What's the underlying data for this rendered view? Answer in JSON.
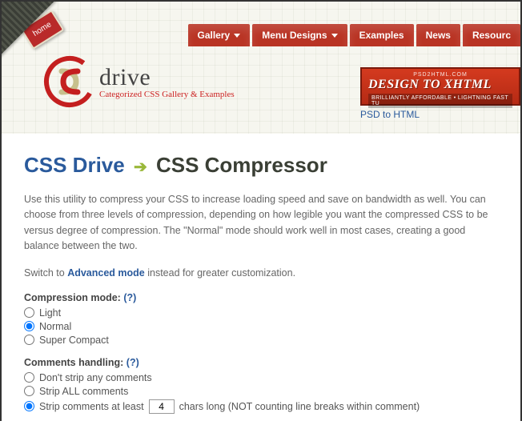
{
  "home_badge": "home",
  "nav": [
    {
      "label": "Gallery",
      "dropdown": true
    },
    {
      "label": "Menu Designs",
      "dropdown": true
    },
    {
      "label": "Examples",
      "dropdown": false
    },
    {
      "label": "News",
      "dropdown": false
    },
    {
      "label": "Resourc",
      "dropdown": false
    }
  ],
  "logo": {
    "title": "drive",
    "subtitle": "Categorized CSS Gallery & Examples"
  },
  "ad": {
    "small": "PSD2HTML.COM",
    "big": "DESIGN TO XHTML",
    "tag": "BRILLIANTLY AFFORDABLE • LIGHTNING FAST TU",
    "link": "PSD to HTML"
  },
  "breadcrumb": {
    "root": "CSS Drive",
    "page": "CSS Compressor"
  },
  "intro": "Use this utility to compress your CSS to increase loading speed and save on bandwidth as well. You can choose from three levels of compression, depending on how legible you want the compressed CSS to be versus degree of compression. The \"Normal\" mode should work well in most cases, creating a good balance between the two.",
  "switch": {
    "pre": "Switch to ",
    "link": "Advanced mode",
    "post": " instead for greater customization."
  },
  "compression": {
    "title": "Compression mode:",
    "help": "(?)",
    "options": [
      "Light",
      "Normal",
      "Super Compact"
    ]
  },
  "comments": {
    "title": "Comments handling:",
    "help": "(?)",
    "opt0": "Don't strip any comments",
    "opt1": "Strip ALL comments",
    "opt2_pre": "Strip comments at least ",
    "opt2_val": "4",
    "opt2_post": " chars long (NOT counting line breaks within comment)"
  }
}
